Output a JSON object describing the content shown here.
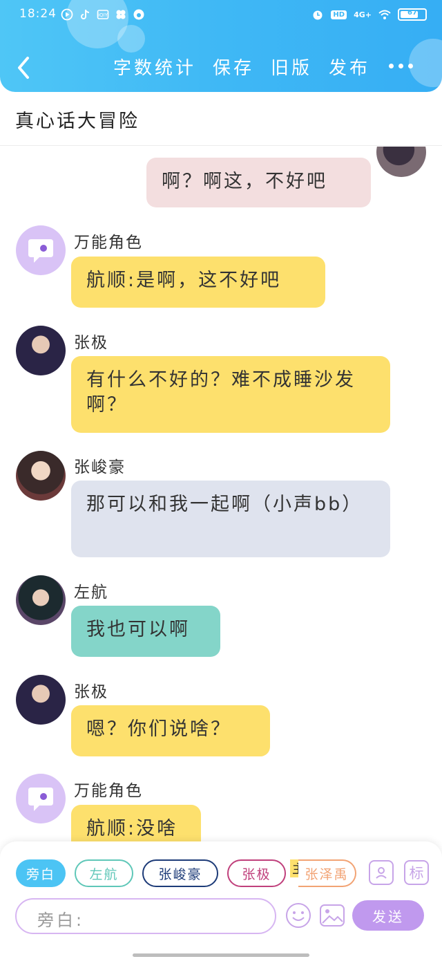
{
  "status": {
    "time": "18:24",
    "network": "4G+",
    "hd": "HD",
    "battery": "67"
  },
  "header": {
    "nav": [
      "字数统计",
      "保存",
      "旧版",
      "发布"
    ]
  },
  "title": "真心话大冒险",
  "messages": [
    {
      "text": "啊？啊这，不好吧"
    },
    {
      "name": "万能角色",
      "text": "航顺:是啊，这不好吧"
    },
    {
      "name": "张极",
      "text": "有什么不好的？难不成睡沙发啊？"
    },
    {
      "name": "张峻豪",
      "text": "那可以和我一起啊（小声bb）"
    },
    {
      "name": "左航",
      "text": "我也可以啊"
    },
    {
      "name": "张极",
      "text": "嗯？你们说啥？"
    },
    {
      "name": "万能角色",
      "text": "航顺:没啥"
    }
  ],
  "bottom": {
    "chips": [
      "旁白",
      "左航",
      "张峻豪",
      "张极",
      "张泽禹"
    ],
    "main_badge": "主",
    "tag_button": "标",
    "input_label": "旁白:",
    "send": "发送"
  },
  "colors": {
    "header": "#3fb8f5",
    "accent_purple": "#c099ee",
    "bubble_yellow": "#fde06d",
    "bubble_gray": "#dfe3ee",
    "bubble_teal": "#84d5c9",
    "bubble_pink": "#f3dedf"
  }
}
